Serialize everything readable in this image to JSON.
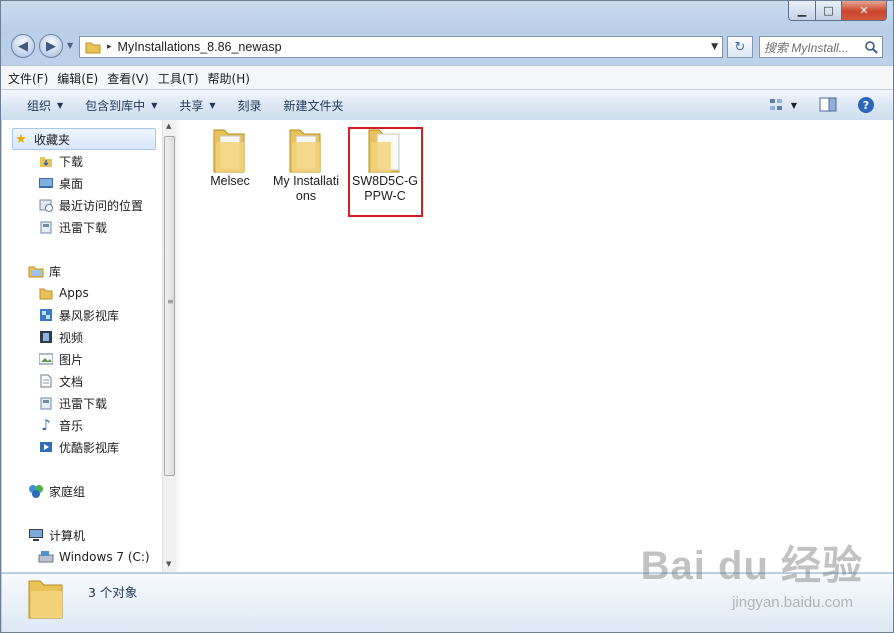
{
  "window": {
    "min_glyph": "▁",
    "max_glyph": "□",
    "close_glyph": "✕"
  },
  "address": {
    "path": "MyInstallations_8.86_newasp",
    "separator": "▸",
    "dropdown": "▼",
    "refresh": "↻"
  },
  "search": {
    "placeholder": "搜索 MyInstall..."
  },
  "menu": [
    "文件(F)",
    "编辑(E)",
    "查看(V)",
    "工具(T)",
    "帮助(H)"
  ],
  "toolbar": {
    "organize": "组织",
    "include_in_library": "包含到库中",
    "share": "共享",
    "burn": "刻录",
    "new_folder": "新建文件夹"
  },
  "nav": {
    "favorites": {
      "label": "收藏夹",
      "items": [
        "下载",
        "桌面",
        "最近访问的位置",
        "迅雷下载"
      ]
    },
    "libraries": {
      "label": "库",
      "items": [
        "Apps",
        "暴风影视库",
        "视频",
        "图片",
        "文档",
        "迅雷下载",
        "音乐",
        "优酷影视库"
      ]
    },
    "homegroup": "家庭组",
    "computer": {
      "label": "计算机",
      "items": [
        "Windows 7 (C:)"
      ]
    }
  },
  "files": [
    {
      "name": "Melsec",
      "selected": false
    },
    {
      "name": "My Installations",
      "selected": false
    },
    {
      "name": "SW8D5C-GPPW-C",
      "selected": false,
      "highlighted": true
    }
  ],
  "status": {
    "count_text": "3 个对象"
  },
  "watermark": {
    "brand": "Bai du 经验",
    "url": "jingyan.baidu.com"
  }
}
